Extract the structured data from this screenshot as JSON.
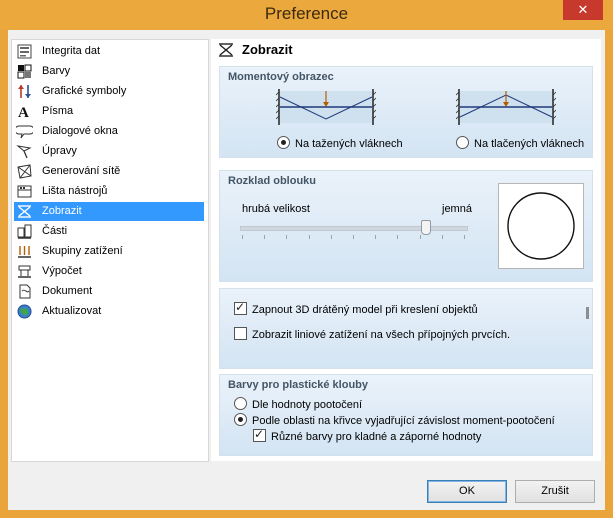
{
  "window": {
    "title": "Preference",
    "close_glyph": "✕"
  },
  "sidebar": {
    "items": [
      {
        "label": "Integrita dat",
        "icon": "data-integrity-icon"
      },
      {
        "label": "Barvy",
        "icon": "colors-icon"
      },
      {
        "label": "Grafické symboly",
        "icon": "graphic-symbols-icon"
      },
      {
        "label": "Písma",
        "icon": "fonts-icon"
      },
      {
        "label": "Dialogové okna",
        "icon": "dialog-windows-icon"
      },
      {
        "label": "Úpravy",
        "icon": "edits-icon"
      },
      {
        "label": "Generování sítě",
        "icon": "mesh-generation-icon"
      },
      {
        "label": "Lišta nástrojů",
        "icon": "toolbar-icon"
      },
      {
        "label": "Zobrazit",
        "icon": "display-icon",
        "selected": true
      },
      {
        "label": "Části",
        "icon": "parts-icon"
      },
      {
        "label": "Skupiny zatížení",
        "icon": "load-groups-icon"
      },
      {
        "label": "Výpočet",
        "icon": "calculation-icon"
      },
      {
        "label": "Dokument",
        "icon": "document-icon"
      },
      {
        "label": "Aktualizovat",
        "icon": "update-globe-icon"
      }
    ]
  },
  "main": {
    "header": {
      "title": "Zobrazit",
      "icon": "display-icon"
    },
    "moment": {
      "title": "Momentový obrazec",
      "option_tension": "Na tažených vláknech",
      "option_compression": "Na tlačených vláknech",
      "selected": "tension"
    },
    "arc": {
      "title": "Rozklad oblouku",
      "label_coarse": "hrubá velikost",
      "label_fine": "jemná",
      "slider_fraction": 0.82
    },
    "render": {
      "option_3d_wire": "Zapnout 3D drátěný model při kreslení objektů",
      "option_3d_wire_checked": true,
      "option_line_load": "Zobrazit liniové zatížení na všech přípojných prvcích.",
      "option_line_load_checked": false
    },
    "hinges": {
      "title": "Barvy pro plastické klouby",
      "option_rotation": "Dle hodnoty pootočení",
      "option_region": "Podle oblasti na křivce vyjadřující závislost moment-pootočení",
      "selected": "region",
      "option_diff_colors": "Různé barvy pro kladné a záporné hodnoty",
      "option_diff_colors_checked": true
    }
  },
  "footer": {
    "ok_label": "OK",
    "cancel_label": "Zrušit"
  }
}
